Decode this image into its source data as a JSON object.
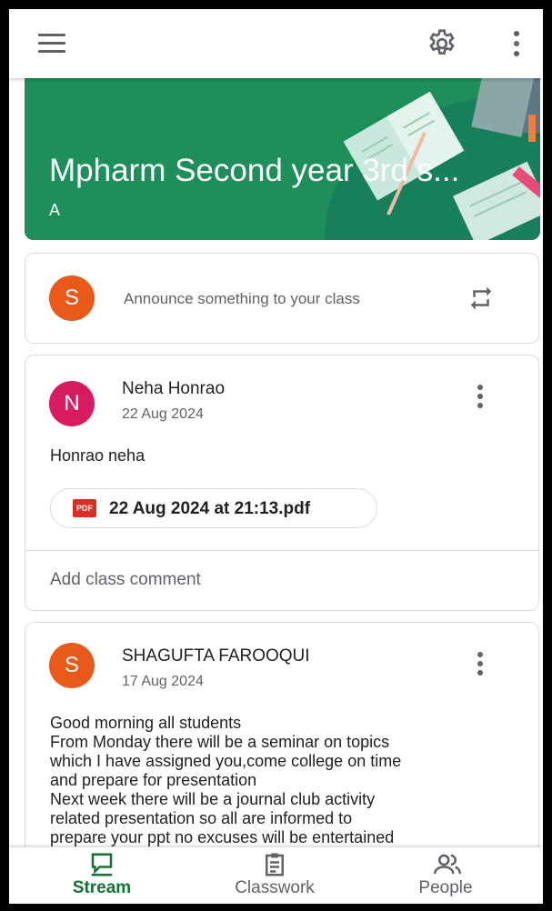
{
  "topbar": {
    "menu_icon": "menu-icon",
    "settings_icon": "gear-icon",
    "more_icon": "more-vert-icon"
  },
  "banner": {
    "title": "Mpharm Second year 3rd s...",
    "section": "A",
    "color": "#1e8e5a"
  },
  "announce": {
    "avatar_letter": "S",
    "avatar_color": "#e8591a",
    "placeholder": "Announce something to your class",
    "icon": "repost-icon"
  },
  "posts": [
    {
      "avatar_letter": "N",
      "avatar_color": "#d81b60",
      "author": "Neha Honrao",
      "date": "22 Aug 2024",
      "body": "Honrao neha",
      "attachment": {
        "icon": "pdf-icon",
        "icon_text": "PDF",
        "name": "22 Aug 2024 at 21:13.pdf"
      },
      "comment_label": "Add class comment"
    },
    {
      "avatar_letter": "S",
      "avatar_color": "#e8591a",
      "author": "SHAGUFTA FAROOQUI",
      "date": "17 Aug 2024",
      "body_lines": [
        "Good morning all students",
        "From Monday there will be a seminar on topics",
        "which I have assigned you,come college on time",
        "and prepare for presentation",
        "Next week there will be a journal club activity",
        "related presentation so all are informed to",
        "prepare your ppt no excuses will be entertained"
      ]
    }
  ],
  "bottom_nav": [
    {
      "label": "Stream",
      "icon": "stream-icon",
      "active": true
    },
    {
      "label": "Classwork",
      "icon": "classwork-icon",
      "active": false
    },
    {
      "label": "People",
      "icon": "people-icon",
      "active": false
    }
  ],
  "colors": {
    "accent": "#137333",
    "text_secondary": "#5f6368"
  }
}
